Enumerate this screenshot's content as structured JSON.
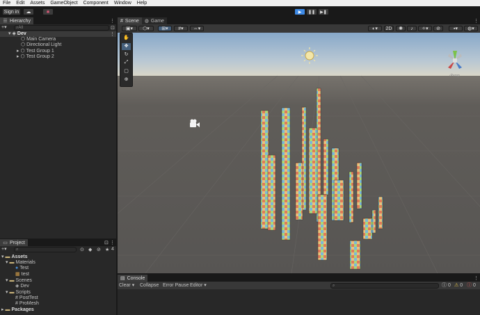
{
  "menu": [
    "File",
    "Edit",
    "Assets",
    "GameObject",
    "Component",
    "Window",
    "Help"
  ],
  "toolbar": {
    "sign_in": "Sign in",
    "play_color": "#3e8ae6"
  },
  "hierarchy": {
    "tab": "Hierarchy",
    "search_placeholder": "All",
    "scene": "Dev",
    "items": [
      {
        "label": "Main Camera"
      },
      {
        "label": "Directional Light"
      },
      {
        "label": "Test Group 1"
      },
      {
        "label": "Test Group 2"
      }
    ]
  },
  "scene": {
    "tabs": [
      "Scene",
      "Game"
    ],
    "mode_2d": "2D",
    "gizmo_label": "Persp",
    "colors": {
      "sky_top": "#87a8c9",
      "horizon": "#d9d6c8",
      "ground": "#575553",
      "toolbar": "#383838"
    }
  },
  "project": {
    "tab": "Project",
    "count": "4",
    "tree": [
      {
        "label": "Assets",
        "level": 0,
        "icon": "folder-icon"
      },
      {
        "label": "Materials",
        "level": 1,
        "icon": "folder-icon"
      },
      {
        "label": "Test",
        "level": 2,
        "icon": "material-icon"
      },
      {
        "label": "test",
        "level": 2,
        "icon": "texture-icon"
      },
      {
        "label": "Scenes",
        "level": 1,
        "icon": "folder-icon"
      },
      {
        "label": "Dev",
        "level": 2,
        "icon": "unity-scene-icon"
      },
      {
        "label": "Scripts",
        "level": 1,
        "icon": "folder-icon"
      },
      {
        "label": "PostTest",
        "level": 2,
        "icon": "script-icon"
      },
      {
        "label": "ProMesh",
        "level": 2,
        "icon": "script-icon"
      },
      {
        "label": "Packages",
        "level": 0,
        "icon": "folder-icon"
      }
    ]
  },
  "console": {
    "tab": "Console",
    "clear": "Clear",
    "collapse": "Collapse",
    "error_pause": "Error Pause",
    "editor": "Editor",
    "counts": {
      "log": "0",
      "warn": "0",
      "error": "0"
    }
  }
}
